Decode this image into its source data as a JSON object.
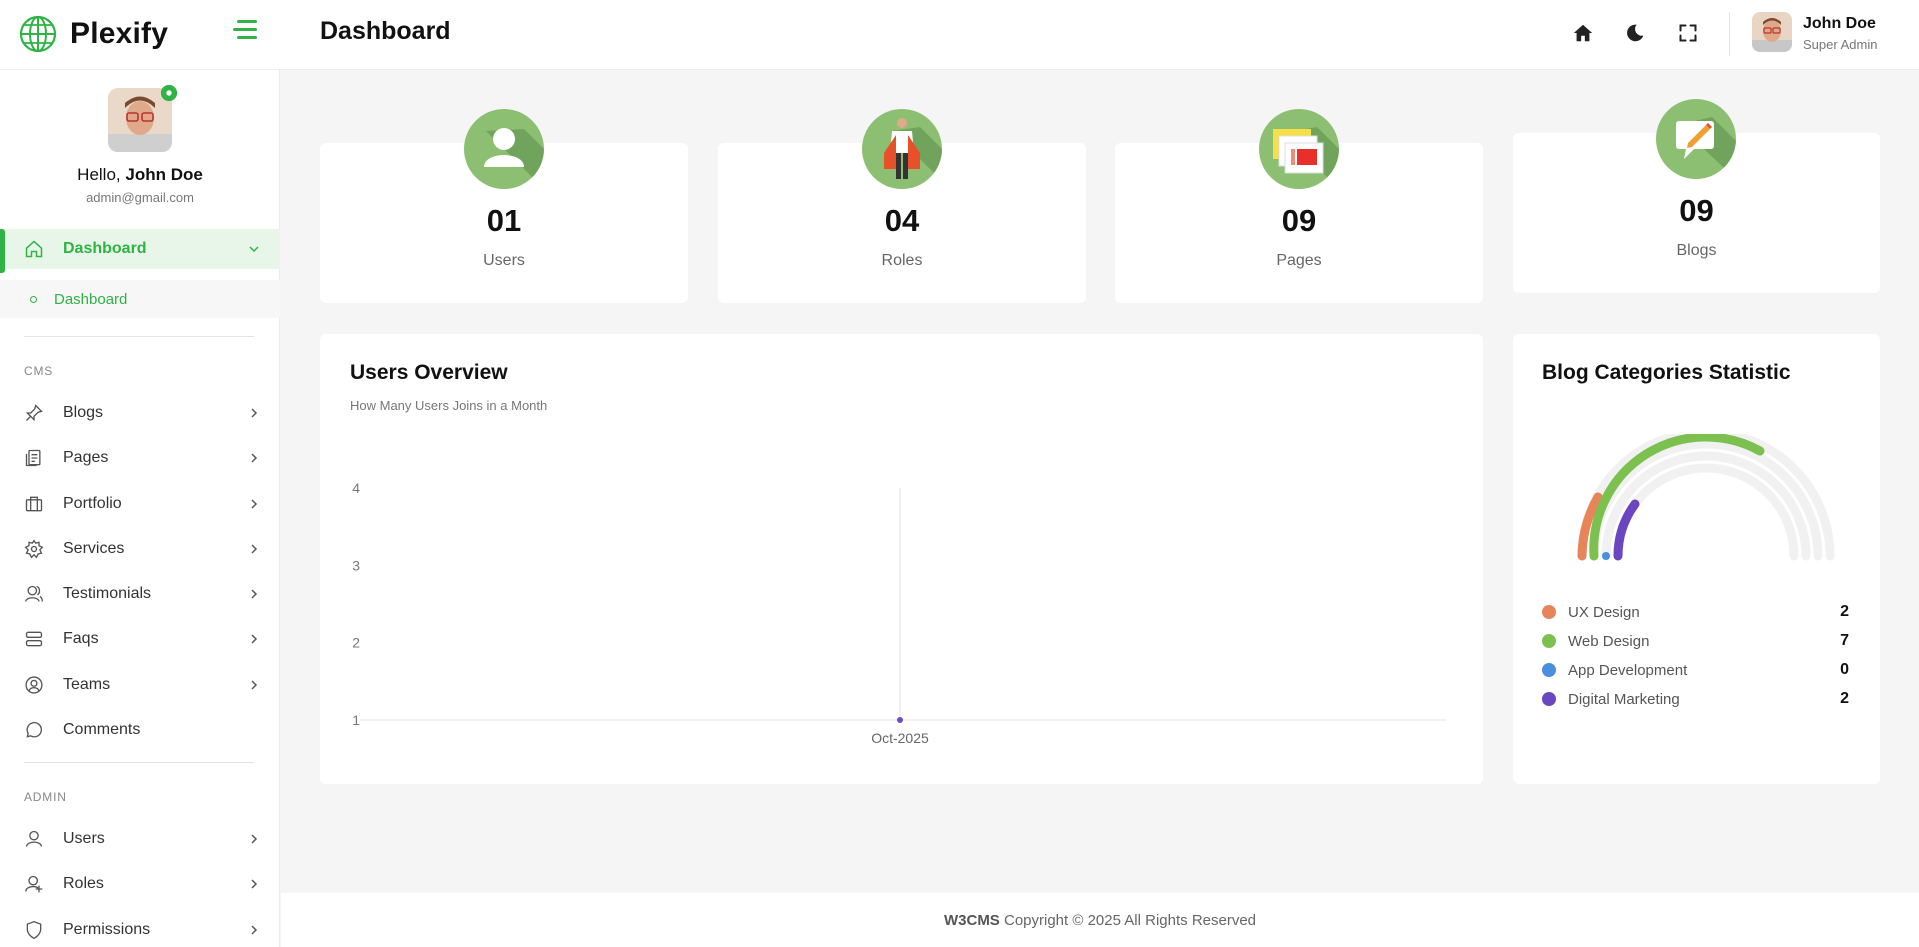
{
  "brand": {
    "name": "Plexify"
  },
  "header": {
    "title": "Dashboard",
    "user": {
      "name": "John Doe",
      "role": "Super Admin"
    }
  },
  "sidebar": {
    "greeting": "Hello,",
    "user_name": "John Doe",
    "email": "admin@gmail.com",
    "active_item": "Dashboard",
    "sub_item": "Dashboard",
    "sections": {
      "cms": "CMS",
      "admin": "ADMIN"
    },
    "cms_items": [
      {
        "label": "Blogs",
        "icon": "pin-icon"
      },
      {
        "label": "Pages",
        "icon": "pages-icon"
      },
      {
        "label": "Portfolio",
        "icon": "briefcase-icon"
      },
      {
        "label": "Services",
        "icon": "gear-icon"
      },
      {
        "label": "Testimonials",
        "icon": "users-icon"
      },
      {
        "label": "Faqs",
        "icon": "faq-icon"
      },
      {
        "label": "Teams",
        "icon": "team-icon"
      },
      {
        "label": "Comments",
        "icon": "comment-icon"
      }
    ],
    "admin_items": [
      {
        "label": "Users",
        "icon": "user-icon"
      },
      {
        "label": "Roles",
        "icon": "role-icon"
      },
      {
        "label": "Permissions",
        "icon": "shield-icon"
      }
    ]
  },
  "stats": [
    {
      "value": "01",
      "label": "Users",
      "icon": "user-avatar-icon"
    },
    {
      "value": "04",
      "label": "Roles",
      "icon": "person-role-icon"
    },
    {
      "value": "09",
      "label": "Pages",
      "icon": "pages-stack-icon"
    },
    {
      "value": "09",
      "label": "Blogs",
      "icon": "blog-pencil-icon"
    }
  ],
  "users_overview": {
    "title": "Users Overview",
    "subtitle": "How Many Users Joins in a Month"
  },
  "blog_categories": {
    "title": "Blog Categories Statistic",
    "items": [
      {
        "label": "UX Design",
        "value": "2",
        "color": "#e8845a"
      },
      {
        "label": "Web Design",
        "value": "7",
        "color": "#7cc04f"
      },
      {
        "label": "App Development",
        "value": "0",
        "color": "#4a8ee0"
      },
      {
        "label": "Digital Marketing",
        "value": "2",
        "color": "#6a46c0"
      }
    ]
  },
  "chart_data": {
    "type": "line",
    "categories": [
      "Oct-2025"
    ],
    "series": [
      {
        "values": [
          1
        ]
      }
    ],
    "y_ticks": [
      "1",
      "2",
      "3",
      "4"
    ],
    "ylim": [
      1,
      4
    ],
    "grid": false
  },
  "footer": {
    "brand": "W3CMS",
    "text": "Copyright © 2025 All Rights Reserved"
  },
  "colors": {
    "accent": "#2fb344",
    "icon_bg": "#8cbf72"
  }
}
